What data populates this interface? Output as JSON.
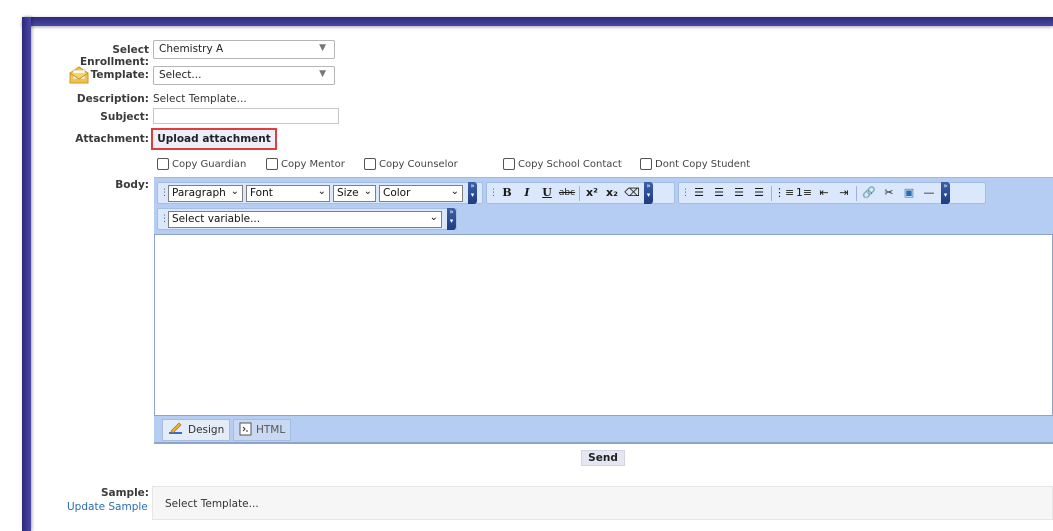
{
  "form": {
    "enrollment_label": "Select Enrollment:",
    "enrollment_value": "Chemistry A",
    "template_label": "Template:",
    "template_value": "Select...",
    "description_label": "Description:",
    "description_value": "Select Template...",
    "subject_label": "Subject:",
    "subject_value": "",
    "attachment_label": "Attachment:",
    "upload_button": "Upload attachment",
    "body_label": "Body:"
  },
  "copy_options": [
    {
      "label": "Copy Guardian",
      "checked": false
    },
    {
      "label": "Copy Mentor",
      "checked": false
    },
    {
      "label": "Copy Counselor",
      "checked": false
    },
    {
      "label": "Copy School Contact",
      "checked": false
    },
    {
      "label": "Dont Copy Student",
      "checked": false
    }
  ],
  "toolbar": {
    "paragraph": "Paragraph",
    "font": "Font",
    "size": "Size",
    "color": "Color",
    "variable": "Select variable..."
  },
  "editor_modes": {
    "design": "Design",
    "html": "HTML"
  },
  "send_button": "Send",
  "sample": {
    "label": "Sample:",
    "update_link": "Update Sample",
    "content": "Select Template..."
  },
  "colors": {
    "frame": "#3a3890",
    "toolbar_bg": "#b5cdf2",
    "upload_border": "#e03c3c",
    "link": "#2a6db5"
  }
}
